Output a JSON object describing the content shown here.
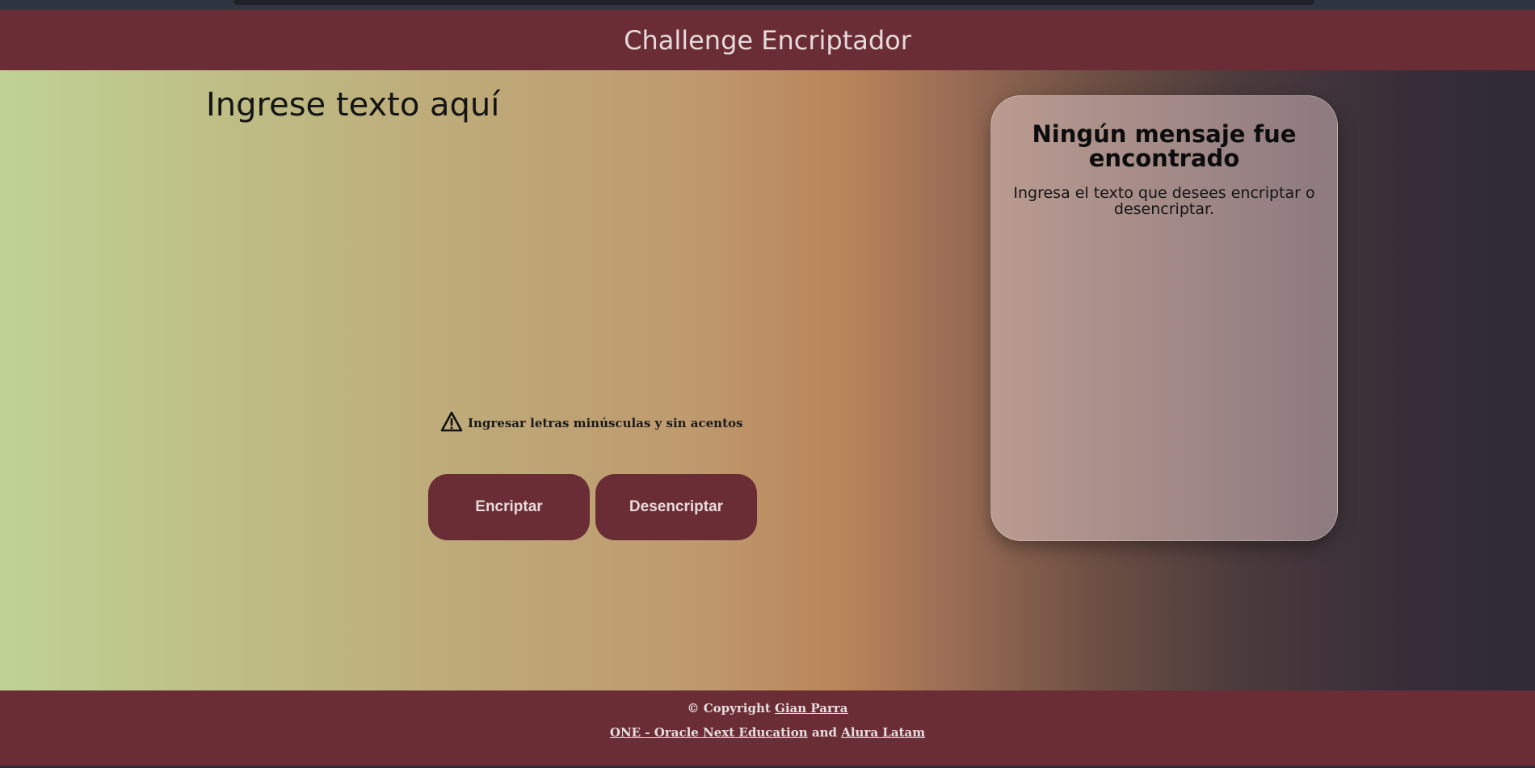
{
  "header": {
    "title": "Challenge Encriptador"
  },
  "input": {
    "placeholder": "Ingrese texto aquí"
  },
  "hint": {
    "icon": "warning-icon",
    "text": "Ingresar letras minúsculas y sin acentos"
  },
  "buttons": {
    "encrypt_label": "Encriptar",
    "decrypt_label": "Desencriptar"
  },
  "output": {
    "title": "Ningún mensaje fue encontrado",
    "message": "Ingresa el texto que desees encriptar o desencriptar."
  },
  "footer": {
    "copyright_prefix": "© Copyright",
    "author_link": "Gian Parra",
    "program_link": "ONE - Oracle Next Education",
    "and_text": "and",
    "partner_link": "Alura Latam"
  },
  "colors": {
    "brand": "#6a2d35",
    "button_text": "#e8dada"
  }
}
